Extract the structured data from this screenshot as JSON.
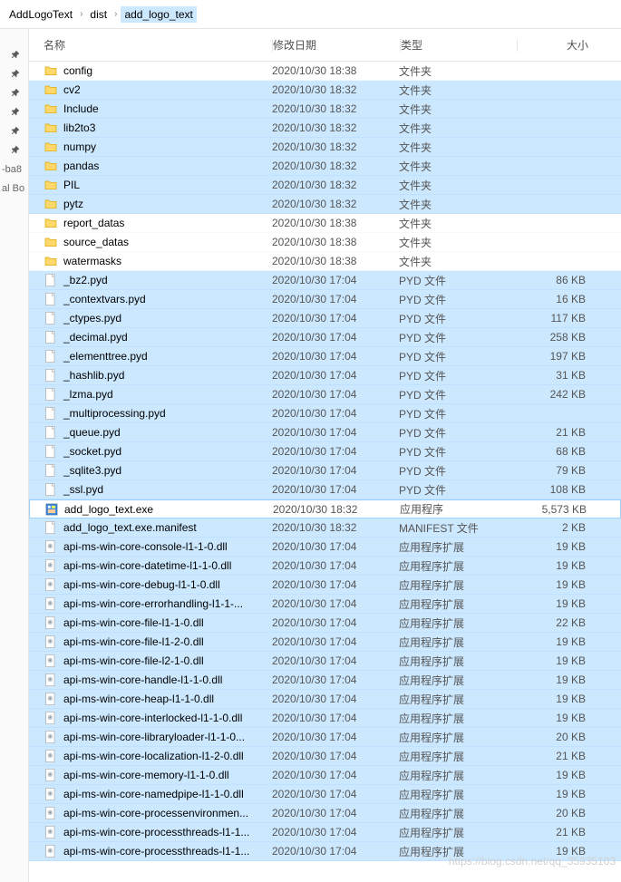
{
  "breadcrumb": [
    {
      "label": "AddLogoText",
      "current": false
    },
    {
      "label": "dist",
      "current": false
    },
    {
      "label": "add_logo_text",
      "current": true
    }
  ],
  "sidebar": {
    "pins": [
      "",
      "",
      "",
      "",
      "",
      ""
    ],
    "items": [
      "-ba8",
      "al Bo"
    ]
  },
  "headers": {
    "name": "名称",
    "date": "修改日期",
    "type": "类型",
    "size": "大小"
  },
  "types": {
    "folder": "文件夹",
    "pyd": "PYD 文件",
    "exe": "应用程序",
    "manifest": "MANIFEST 文件",
    "dll": "应用程序扩展"
  },
  "rows": [
    {
      "icon": "folder",
      "name": "config",
      "date": "2020/10/30 18:38",
      "type": "folder",
      "size": "",
      "sel": false
    },
    {
      "icon": "folder",
      "name": "cv2",
      "date": "2020/10/30 18:32",
      "type": "folder",
      "size": "",
      "sel": true
    },
    {
      "icon": "folder",
      "name": "Include",
      "date": "2020/10/30 18:32",
      "type": "folder",
      "size": "",
      "sel": true
    },
    {
      "icon": "folder",
      "name": "lib2to3",
      "date": "2020/10/30 18:32",
      "type": "folder",
      "size": "",
      "sel": true
    },
    {
      "icon": "folder",
      "name": "numpy",
      "date": "2020/10/30 18:32",
      "type": "folder",
      "size": "",
      "sel": true
    },
    {
      "icon": "folder",
      "name": "pandas",
      "date": "2020/10/30 18:32",
      "type": "folder",
      "size": "",
      "sel": true
    },
    {
      "icon": "folder",
      "name": "PIL",
      "date": "2020/10/30 18:32",
      "type": "folder",
      "size": "",
      "sel": true
    },
    {
      "icon": "folder",
      "name": "pytz",
      "date": "2020/10/30 18:32",
      "type": "folder",
      "size": "",
      "sel": true
    },
    {
      "icon": "folder",
      "name": "report_datas",
      "date": "2020/10/30 18:38",
      "type": "folder",
      "size": "",
      "sel": false
    },
    {
      "icon": "folder",
      "name": "source_datas",
      "date": "2020/10/30 18:38",
      "type": "folder",
      "size": "",
      "sel": false
    },
    {
      "icon": "folder",
      "name": "watermasks",
      "date": "2020/10/30 18:38",
      "type": "folder",
      "size": "",
      "sel": false
    },
    {
      "icon": "file",
      "name": "_bz2.pyd",
      "date": "2020/10/30 17:04",
      "type": "pyd",
      "size": "86 KB",
      "sel": true
    },
    {
      "icon": "file",
      "name": "_contextvars.pyd",
      "date": "2020/10/30 17:04",
      "type": "pyd",
      "size": "16 KB",
      "sel": true
    },
    {
      "icon": "file",
      "name": "_ctypes.pyd",
      "date": "2020/10/30 17:04",
      "type": "pyd",
      "size": "117 KB",
      "sel": true
    },
    {
      "icon": "file",
      "name": "_decimal.pyd",
      "date": "2020/10/30 17:04",
      "type": "pyd",
      "size": "258 KB",
      "sel": true
    },
    {
      "icon": "file",
      "name": "_elementtree.pyd",
      "date": "2020/10/30 17:04",
      "type": "pyd",
      "size": "197 KB",
      "sel": true
    },
    {
      "icon": "file",
      "name": "_hashlib.pyd",
      "date": "2020/10/30 17:04",
      "type": "pyd",
      "size": "31 KB",
      "sel": true
    },
    {
      "icon": "file",
      "name": "_lzma.pyd",
      "date": "2020/10/30 17:04",
      "type": "pyd",
      "size": "242 KB",
      "sel": true
    },
    {
      "icon": "file",
      "name": "_multiprocessing.pyd",
      "date": "2020/10/30 17:04",
      "type": "pyd",
      "size": "",
      "sel": true
    },
    {
      "icon": "file",
      "name": "_queue.pyd",
      "date": "2020/10/30 17:04",
      "type": "pyd",
      "size": "21 KB",
      "sel": true
    },
    {
      "icon": "file",
      "name": "_socket.pyd",
      "date": "2020/10/30 17:04",
      "type": "pyd",
      "size": "68 KB",
      "sel": true
    },
    {
      "icon": "file",
      "name": "_sqlite3.pyd",
      "date": "2020/10/30 17:04",
      "type": "pyd",
      "size": "79 KB",
      "sel": true
    },
    {
      "icon": "file",
      "name": "_ssl.pyd",
      "date": "2020/10/30 17:04",
      "type": "pyd",
      "size": "108 KB",
      "sel": true
    },
    {
      "icon": "exe",
      "name": "add_logo_text.exe",
      "date": "2020/10/30 18:32",
      "type": "exe",
      "size": "5,573 KB",
      "sel": false,
      "exeRow": true
    },
    {
      "icon": "file",
      "name": "add_logo_text.exe.manifest",
      "date": "2020/10/30 18:32",
      "type": "manifest",
      "size": "2 KB",
      "sel": true
    },
    {
      "icon": "dll",
      "name": "api-ms-win-core-console-l1-1-0.dll",
      "date": "2020/10/30 17:04",
      "type": "dll",
      "size": "19 KB",
      "sel": true
    },
    {
      "icon": "dll",
      "name": "api-ms-win-core-datetime-l1-1-0.dll",
      "date": "2020/10/30 17:04",
      "type": "dll",
      "size": "19 KB",
      "sel": true
    },
    {
      "icon": "dll",
      "name": "api-ms-win-core-debug-l1-1-0.dll",
      "date": "2020/10/30 17:04",
      "type": "dll",
      "size": "19 KB",
      "sel": true
    },
    {
      "icon": "dll",
      "name": "api-ms-win-core-errorhandling-l1-1-...",
      "date": "2020/10/30 17:04",
      "type": "dll",
      "size": "19 KB",
      "sel": true
    },
    {
      "icon": "dll",
      "name": "api-ms-win-core-file-l1-1-0.dll",
      "date": "2020/10/30 17:04",
      "type": "dll",
      "size": "22 KB",
      "sel": true
    },
    {
      "icon": "dll",
      "name": "api-ms-win-core-file-l1-2-0.dll",
      "date": "2020/10/30 17:04",
      "type": "dll",
      "size": "19 KB",
      "sel": true
    },
    {
      "icon": "dll",
      "name": "api-ms-win-core-file-l2-1-0.dll",
      "date": "2020/10/30 17:04",
      "type": "dll",
      "size": "19 KB",
      "sel": true
    },
    {
      "icon": "dll",
      "name": "api-ms-win-core-handle-l1-1-0.dll",
      "date": "2020/10/30 17:04",
      "type": "dll",
      "size": "19 KB",
      "sel": true
    },
    {
      "icon": "dll",
      "name": "api-ms-win-core-heap-l1-1-0.dll",
      "date": "2020/10/30 17:04",
      "type": "dll",
      "size": "19 KB",
      "sel": true
    },
    {
      "icon": "dll",
      "name": "api-ms-win-core-interlocked-l1-1-0.dll",
      "date": "2020/10/30 17:04",
      "type": "dll",
      "size": "19 KB",
      "sel": true
    },
    {
      "icon": "dll",
      "name": "api-ms-win-core-libraryloader-l1-1-0...",
      "date": "2020/10/30 17:04",
      "type": "dll",
      "size": "20 KB",
      "sel": true
    },
    {
      "icon": "dll",
      "name": "api-ms-win-core-localization-l1-2-0.dll",
      "date": "2020/10/30 17:04",
      "type": "dll",
      "size": "21 KB",
      "sel": true
    },
    {
      "icon": "dll",
      "name": "api-ms-win-core-memory-l1-1-0.dll",
      "date": "2020/10/30 17:04",
      "type": "dll",
      "size": "19 KB",
      "sel": true
    },
    {
      "icon": "dll",
      "name": "api-ms-win-core-namedpipe-l1-1-0.dll",
      "date": "2020/10/30 17:04",
      "type": "dll",
      "size": "19 KB",
      "sel": true
    },
    {
      "icon": "dll",
      "name": "api-ms-win-core-processenvironmen...",
      "date": "2020/10/30 17:04",
      "type": "dll",
      "size": "20 KB",
      "sel": true
    },
    {
      "icon": "dll",
      "name": "api-ms-win-core-processthreads-l1-1...",
      "date": "2020/10/30 17:04",
      "type": "dll",
      "size": "21 KB",
      "sel": true
    },
    {
      "icon": "dll",
      "name": "api-ms-win-core-processthreads-l1-1...",
      "date": "2020/10/30 17:04",
      "type": "dll",
      "size": "19 KB",
      "sel": true
    }
  ],
  "watermark": "https://blog.csdn.net/qq_35935103"
}
